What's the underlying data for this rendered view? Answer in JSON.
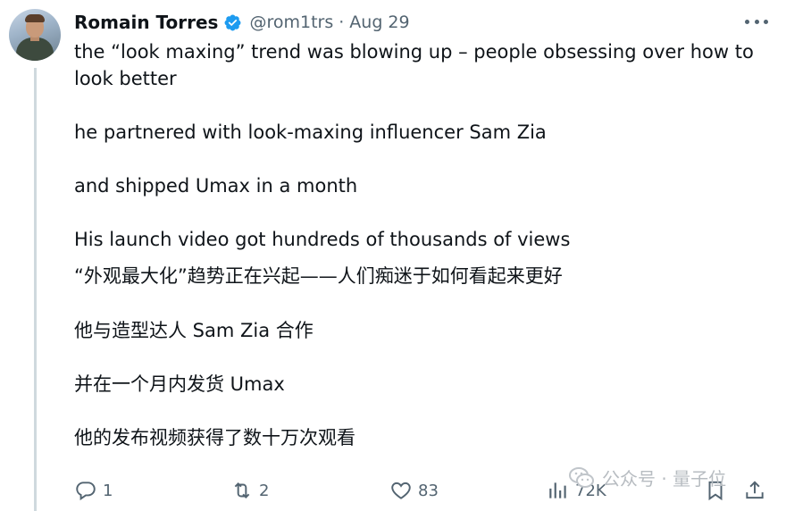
{
  "author": {
    "name": "Romain Torres",
    "handle": "@rom1trs",
    "separator": "·",
    "date": "Aug 29"
  },
  "tweet_lines": [
    "the “look maxing” trend was blowing up  – people obsessing over how to",
    "look better",
    "he partnered with look-maxing influencer Sam Zia",
    "and shipped Umax in a month",
    "His launch video got hundreds of thousands of views",
    "“外观最大化”趋势正在兴起——人们痴迷于如何看起来更好",
    "他与造型达人 Sam Zia 合作",
    "并在一个月内发货 Umax",
    "他的发布视频获得了数十万次观看"
  ],
  "actions": {
    "replies": "1",
    "reposts": "2",
    "likes": "83",
    "views": "72K"
  },
  "watermark": {
    "text": "公众号 · 量子位"
  },
  "colors": {
    "verified": "#1d9bf0",
    "muted": "#536471",
    "text": "#0f1419",
    "thread_line": "#cfd9de"
  }
}
